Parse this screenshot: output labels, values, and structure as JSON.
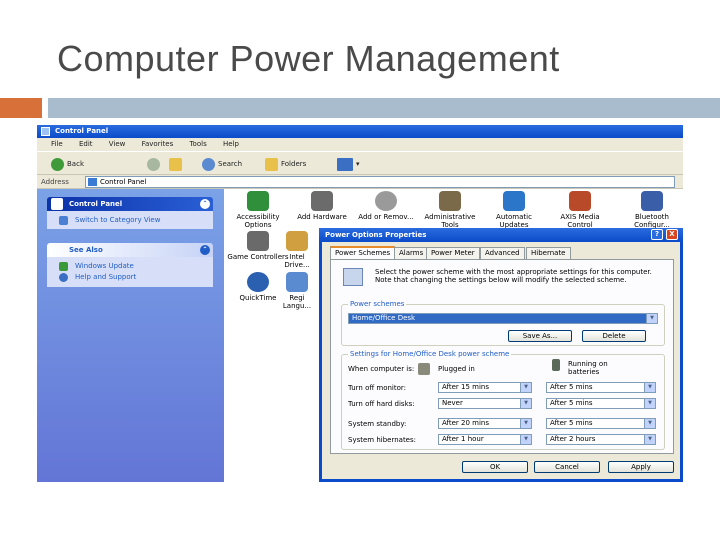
{
  "slide": {
    "title": "Computer Power Management"
  },
  "control_panel": {
    "window_title": "Control Panel",
    "menu": [
      "File",
      "Edit",
      "View",
      "Favorites",
      "Tools",
      "Help"
    ],
    "toolbar": {
      "back": "Back",
      "search": "Search",
      "folders": "Folders"
    },
    "address_label": "Address",
    "address_value": "Control Panel",
    "sidebar": {
      "panel_title": "Control Panel",
      "switch_link": "Switch to Category View",
      "see_also_title": "See Also",
      "see_also_items": [
        "Windows Update",
        "Help and Support"
      ]
    },
    "items": [
      {
        "label": "Accessibility Options",
        "color": "#2f8f3a"
      },
      {
        "label": "Add Hardware",
        "color": "#6b6b6b"
      },
      {
        "label": "Add or Remov...",
        "color": "#9a9a9a"
      },
      {
        "label": "Administrative Tools",
        "color": "#7a6a4a"
      },
      {
        "label": "Automatic Updates",
        "color": "#2b76c9"
      },
      {
        "label": "AXIS Media Control",
        "color": "#b84a2a"
      },
      {
        "label": "Bluetooth Configur...",
        "color": "#3a5fa8"
      },
      {
        "label": "Game Controllers",
        "color": "#6a6a6a"
      },
      {
        "label": "Intel Drive...",
        "color": "#d0a040"
      },
      {
        "label": "QuickTime",
        "color": "#2b5fb0"
      },
      {
        "label": "Regi Langu...",
        "color": "#5a8ad0"
      }
    ]
  },
  "dialog": {
    "title": "Power Options Properties",
    "help_glyph": "?",
    "close_glyph": "X",
    "tabs": [
      "Power Schemes",
      "Alarms",
      "Power Meter",
      "Advanced",
      "Hibernate"
    ],
    "description": "Select the power scheme with the most appropriate settings for this computer. Note that changing the settings below will modify the selected scheme.",
    "power_schemes_label": "Power schemes",
    "selected_scheme": "Home/Office Desk",
    "save_as": "Save As...",
    "delete": "Delete",
    "settings_label": "Settings for Home/Office Desk power scheme",
    "when_computer_is": "When computer is:",
    "col_plugged": "Plugged in",
    "col_batteries": "Running on batteries",
    "rows": [
      {
        "label": "Turn off monitor:",
        "plugged": "After 15 mins",
        "battery": "After 5 mins"
      },
      {
        "label": "Turn off hard disks:",
        "plugged": "Never",
        "battery": "After 5 mins"
      },
      {
        "label": "System standby:",
        "plugged": "After 20 mins",
        "battery": "After 5 mins"
      },
      {
        "label": "System hibernates:",
        "plugged": "After 1 hour",
        "battery": "After 2 hours"
      }
    ],
    "ok": "OK",
    "cancel": "Cancel",
    "apply": "Apply"
  }
}
